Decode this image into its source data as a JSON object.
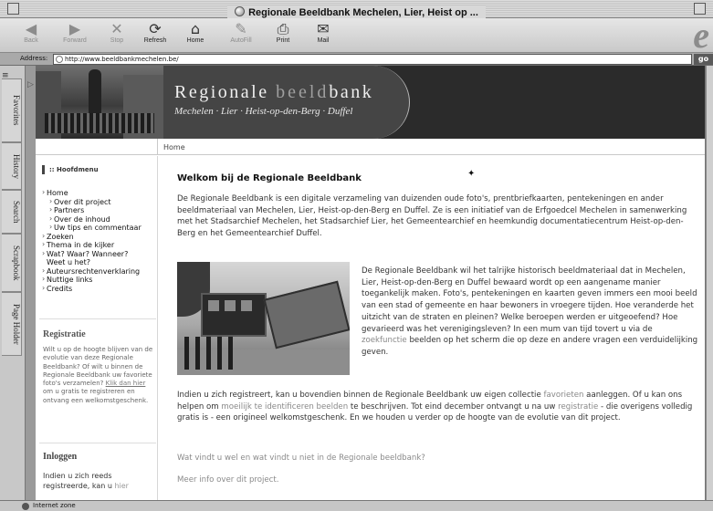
{
  "window": {
    "title": "Regionale Beeldbank Mechelen, Lier, Heist op ..."
  },
  "toolbar": {
    "back": "Back",
    "forward": "Forward",
    "stop": "Stop",
    "refresh": "Refresh",
    "home": "Home",
    "autofill": "AutoFill",
    "print": "Print",
    "mail": "Mail"
  },
  "address": {
    "label": "Address:",
    "url": "http://www.beeldbankmechelen.be/",
    "go": "go"
  },
  "sidetabs": [
    "Favorites",
    "History",
    "Search",
    "Scrapbook",
    "Page Holder"
  ],
  "banner": {
    "title_regionale": "Regionale",
    "title_beeld": "beeld",
    "title_bank": "bank",
    "subtitle": "Mechelen · Lier · Heist-op-den-Berg · Duffel"
  },
  "breadcrumb": "Home",
  "nav": {
    "heading": ":: Hoofdmenu",
    "items": [
      {
        "label": "Home",
        "level": 0
      },
      {
        "label": "Over dit project",
        "level": 1
      },
      {
        "label": "Partners",
        "level": 1
      },
      {
        "label": "Over de inhoud",
        "level": 1
      },
      {
        "label": "Uw tips en commentaar",
        "level": 1
      },
      {
        "label": "Zoeken",
        "level": 0
      },
      {
        "label": "Thema in de kijker",
        "level": 0
      },
      {
        "label": "Wat? Waar? Wanneer?",
        "level": 0
      },
      {
        "label": "Weet u het?",
        "level": 0
      },
      {
        "label": "Auteursrechtenverklaring",
        "level": 0
      },
      {
        "label": "Nuttige links",
        "level": 0
      },
      {
        "label": "Credits",
        "level": 0
      }
    ]
  },
  "registratie": {
    "title": "Registratie",
    "text_before": "Wilt u op de hoogte blijven van de evolutie van deze Regionale Beeldbank? Of wilt u binnen de Regionale Beeldbank uw favoriete foto's verzamelen?",
    "link": "Klik dan hier",
    "text_after": "om u gratis te registreren en ontvang een welkomstgeschenk."
  },
  "inloggen": {
    "title": "Inloggen",
    "text": "Indien u zich reeds registreerde, kan u",
    "link": "hier"
  },
  "main": {
    "heading": "Welkom bij de Regionale Beeldbank",
    "p1": "De Regionale Beeldbank is een digitale verzameling van duizenden oude foto's, prentbriefkaarten, pentekeningen en ander beeldmateriaal van Mechelen, Lier, Heist-op-den-Berg en Duffel. Ze is een initiatief van de Erfgoedcel Mechelen in samenwerking met het Stadsarchief Mechelen, het Stadsarchief Lier, het Gemeentearchief en heemkundig documentatiecentrum Heist-op-den-Berg en het Gemeentearchief Duffel.",
    "p2_before": "De Regionale Beeldbank wil het talrijke historisch beeldmateriaal dat in Mechelen, Lier, Heist-op-den-Berg en Duffel bewaard wordt op een aangename manier toegankelijk maken. Foto's, pentekeningen en kaarten geven immers een mooi beeld van een stad of gemeente en haar bewoners in vroegere tijden. Hoe veranderde het uitzicht van de straten en pleinen? Welke beroepen werden er uitgeoefend? Hoe gevarieerd was het verenigingsleven? In een mum van tijd tovert u via de",
    "p2_link": "zoekfunctie",
    "p2_after": "beelden op het scherm die op deze en andere vragen een verduidelijking geven.",
    "p3_a": "Indien u zich registreert, kan u bovendien binnen de Regionale Beeldbank uw eigen collectie",
    "p3_link1": "favorieten",
    "p3_b": "aanleggen. Of u kan ons helpen om",
    "p3_link2": "moeilijk te identificeren beelden",
    "p3_c": "te beschrijven. Tot eind december ontvangt u na uw",
    "p3_link3": "registratie",
    "p3_d": "- die overigens volledig gratis is - een origineel welkomstgeschenk. En we houden u verder op de hoogte van de evolutie van dit project.",
    "q1": "Wat vindt u wel en wat vindt u niet in de Regionale beeldbank?",
    "q2": "Meer info over dit project."
  },
  "status": {
    "text": "Internet zone"
  }
}
